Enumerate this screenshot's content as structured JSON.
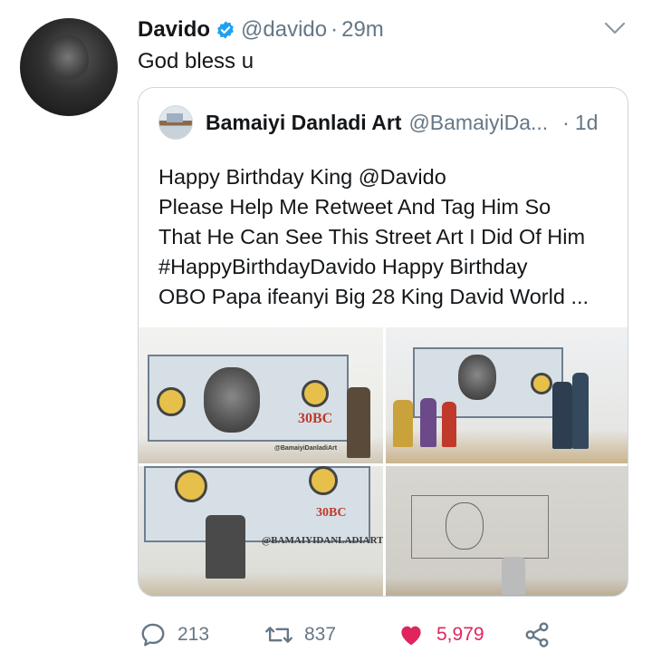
{
  "tweet": {
    "author_name": "Davido",
    "author_handle": "@davido",
    "separator": "·",
    "time": "29m",
    "text": "God bless u"
  },
  "quoted": {
    "author_name": "Bamaiyi Danladi Art",
    "author_handle": "@BamaiyiDa...",
    "separator": "·",
    "time": "1d",
    "text": "Happy Birthday King  @Davido\nPlease Help Me Retweet And Tag Him So\nThat He Can See This Street Art I Did Of Him\n #HappyBirthdayDavido Happy Birthday\nOBO Papa ifeanyi Big 28 King David World ..."
  },
  "photos": {
    "p1_bill_text": "30BC",
    "p1_signature": "@BamaiyiDanladiArt",
    "p3_bill_text": "30BC",
    "p3_watermark": "@BAMAIYIDANLADIART"
  },
  "actions": {
    "replies": "213",
    "retweets": "837",
    "likes": "5,979"
  },
  "colors": {
    "verified": "#1da1f2",
    "like": "#e0245e",
    "muted": "#657786"
  },
  "icons": [
    "verified-badge-icon",
    "chevron-down-icon",
    "reply-icon",
    "retweet-icon",
    "heart-icon",
    "share-icon"
  ]
}
